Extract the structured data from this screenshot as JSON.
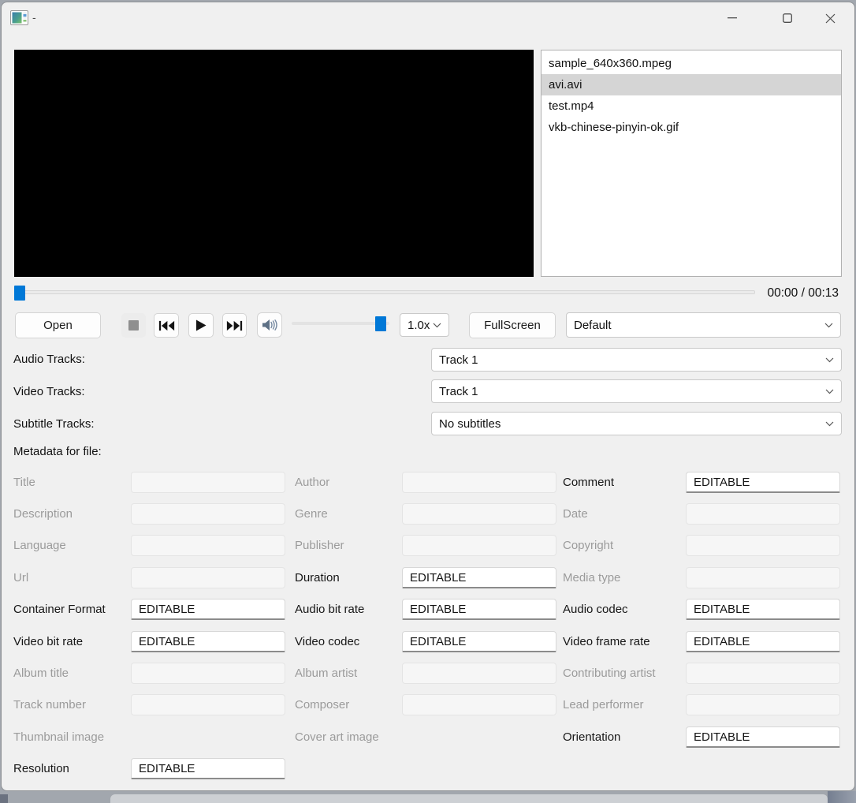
{
  "window": {
    "title": "-",
    "controls": {
      "minimize": "minimize",
      "maximize": "maximize",
      "close": "close"
    }
  },
  "playlist": {
    "items": [
      "sample_640x360.mpeg",
      "avi.avi",
      "test.mp4",
      "vkb-chinese-pinyin-ok.gif"
    ],
    "selected_index": 1
  },
  "transport": {
    "open_label": "Open",
    "fullscreen_label": "FullScreen",
    "speed_value": "1.0x",
    "color_mode_value": "Default",
    "time_display": "00:00 / 00:13",
    "icons": [
      "stop-icon",
      "skip-previous-icon",
      "play-icon",
      "skip-next-icon",
      "volume-icon"
    ]
  },
  "tracks": {
    "audio_label": "Audio Tracks:",
    "audio_value": "Track 1",
    "video_label": "Video Tracks:",
    "video_value": "Track 1",
    "subtitle_label": "Subtitle Tracks:",
    "subtitle_value": "No subtitles"
  },
  "metadata": {
    "header": "Metadata for file:",
    "editable_text": "EDITABLE",
    "rows": [
      [
        {
          "label": "Title",
          "state": "disabled"
        },
        {
          "label": "Author",
          "state": "disabled"
        },
        {
          "label": "Comment",
          "state": "editable"
        }
      ],
      [
        {
          "label": "Description",
          "state": "disabled"
        },
        {
          "label": "Genre",
          "state": "disabled"
        },
        {
          "label": "Date",
          "state": "disabled"
        }
      ],
      [
        {
          "label": "Language",
          "state": "disabled"
        },
        {
          "label": "Publisher",
          "state": "disabled"
        },
        {
          "label": "Copyright",
          "state": "disabled"
        }
      ],
      [
        {
          "label": "Url",
          "state": "disabled"
        },
        {
          "label": "Duration",
          "state": "editable"
        },
        {
          "label": "Media type",
          "state": "disabled"
        }
      ],
      [
        {
          "label": "Container Format",
          "state": "editable"
        },
        {
          "label": "Audio bit rate",
          "state": "editable"
        },
        {
          "label": "Audio codec",
          "state": "editable"
        }
      ],
      [
        {
          "label": "Video bit rate",
          "state": "editable"
        },
        {
          "label": "Video codec",
          "state": "editable"
        },
        {
          "label": "Video frame rate",
          "state": "editable"
        }
      ],
      [
        {
          "label": "Album title",
          "state": "disabled"
        },
        {
          "label": "Album artist",
          "state": "disabled"
        },
        {
          "label": "Contributing artist",
          "state": "disabled"
        }
      ],
      [
        {
          "label": "Track number",
          "state": "disabled"
        },
        {
          "label": "Composer",
          "state": "disabled"
        },
        {
          "label": "Lead performer",
          "state": "disabled"
        }
      ],
      [
        {
          "label": "Thumbnail image",
          "state": "label-only"
        },
        {
          "label": "Cover art image",
          "state": "label-only"
        },
        {
          "label": "Orientation",
          "state": "editable"
        }
      ],
      [
        {
          "label": "Resolution",
          "state": "editable"
        },
        {
          "label": "",
          "state": "empty"
        },
        {
          "label": "",
          "state": "empty"
        }
      ]
    ]
  },
  "colors": {
    "accent": "#0078d7"
  }
}
